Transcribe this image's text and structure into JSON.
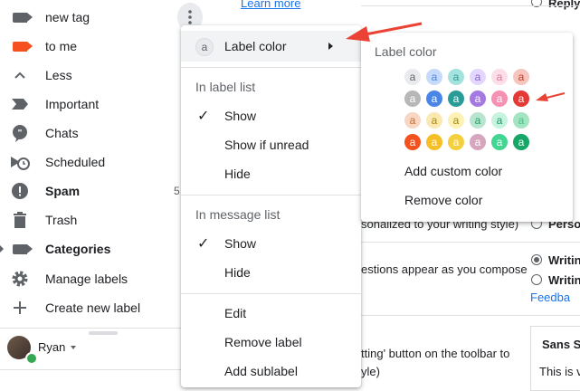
{
  "sidebar": {
    "items": [
      {
        "label": "new tag",
        "icon": "label-icon",
        "color": "#5f6368",
        "bold": false
      },
      {
        "label": "to me",
        "icon": "label-icon",
        "color": "#f4511e",
        "bold": false
      },
      {
        "label": "Less",
        "icon": "chevron-up-icon",
        "bold": false
      },
      {
        "label": "Important",
        "icon": "important-icon",
        "bold": false
      },
      {
        "label": "Chats",
        "icon": "chat-icon",
        "bold": false
      },
      {
        "label": "Scheduled",
        "icon": "scheduled-icon",
        "bold": false
      },
      {
        "label": "Spam",
        "icon": "spam-icon",
        "bold": true,
        "count": "5"
      },
      {
        "label": "Trash",
        "icon": "trash-icon",
        "bold": false
      },
      {
        "label": "Categories",
        "icon": "label-icon",
        "color": "#5f6368",
        "bold": true
      },
      {
        "label": "Manage labels",
        "icon": "gear-icon",
        "bold": false
      },
      {
        "label": "Create new label",
        "icon": "plus-icon",
        "bold": false
      }
    ],
    "user": {
      "name": "Ryan"
    }
  },
  "background": {
    "link_top": "Learn more",
    "reply_top": "Reply",
    "personalized_text": "sonalized to your writing style)",
    "personalized_option": "Perso",
    "suggestions_text": "estions appear as you compose",
    "writing_on": "Writin",
    "writing_off": "Writin",
    "feedback": "Feedba",
    "toolbar_text": "tting' button on the toolbar to",
    "style_text": "yle)",
    "font_select": "Sans S",
    "preview_text": "This is v"
  },
  "menu": {
    "label_color": "Label color",
    "icon_letter": "a",
    "in_label_list": "In label list",
    "label_list_options": [
      "Show",
      "Show if unread",
      "Hide"
    ],
    "in_message_list": "In message list",
    "message_list_options": [
      "Show",
      "Hide"
    ],
    "edit": "Edit",
    "remove_label": "Remove label",
    "add_sublabel": "Add sublabel"
  },
  "palette": {
    "title": "Label color",
    "letter": "a",
    "rows": [
      [
        {
          "bg": "#e8eaed",
          "fg": "#5f6368"
        },
        {
          "bg": "#c6dafc",
          "fg": "#4a86e8"
        },
        {
          "bg": "#a4e2de",
          "fg": "#2a9c97"
        },
        {
          "bg": "#e3d7ff",
          "fg": "#8e63ce"
        },
        {
          "bg": "#fcdee8",
          "fg": "#e07798"
        },
        {
          "bg": "#f6c5be",
          "fg": "#cc3a21"
        }
      ],
      [
        {
          "bg": "#b7b7b7",
          "fg": "#ffffff"
        },
        {
          "bg": "#4a86e8",
          "fg": "#ffffff"
        },
        {
          "bg": "#2a9c97",
          "fg": "#ffffff"
        },
        {
          "bg": "#a479e2",
          "fg": "#ffffff"
        },
        {
          "bg": "#f691b3",
          "fg": "#ffffff"
        },
        {
          "bg": "#e53935",
          "fg": "#ffffff"
        }
      ],
      [
        {
          "bg": "#f7d7c4",
          "fg": "#d06b22"
        },
        {
          "bg": "#fce8b3",
          "fg": "#ab8b00"
        },
        {
          "bg": "#fef1b6",
          "fg": "#a08800"
        },
        {
          "bg": "#b9e4d0",
          "fg": "#16a766"
        },
        {
          "bg": "#c6f3de",
          "fg": "#149e60"
        },
        {
          "bg": "#a4e4c0",
          "fg": "#3dc789"
        }
      ],
      [
        {
          "bg": "#f4511e",
          "fg": "#ffffff"
        },
        {
          "bg": "#f6bf26",
          "fg": "#ffffff"
        },
        {
          "bg": "#f4d03f",
          "fg": "#ffffff"
        },
        {
          "bg": "#d5a6bd",
          "fg": "#ffffff"
        },
        {
          "bg": "#43d692",
          "fg": "#ffffff"
        },
        {
          "bg": "#16a766",
          "fg": "#ffffff"
        }
      ]
    ],
    "add_custom": "Add custom color",
    "remove": "Remove color"
  },
  "colors": {
    "annotation": "#ea4335",
    "menu_highlight": "#f1f3f4"
  }
}
